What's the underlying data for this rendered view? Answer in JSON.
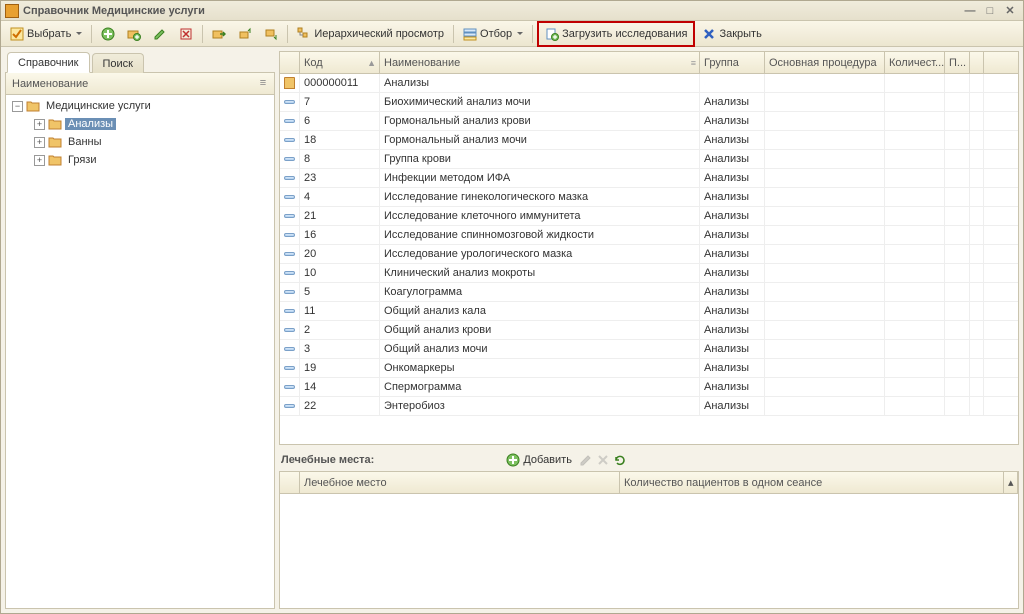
{
  "window": {
    "title": "Справочник Медицинские услуги"
  },
  "toolbar": {
    "select": "Выбрать",
    "hier_view": "Иерархический просмотр",
    "filter": "Отбор",
    "load_research": "Загрузить исследования",
    "close": "Закрыть"
  },
  "tabs": {
    "directory": "Справочник",
    "search": "Поиск"
  },
  "tree": {
    "col": "Наименование",
    "root": "Медицинские услуги",
    "children": [
      {
        "label": "Анализы",
        "selected": true
      },
      {
        "label": "Ванны",
        "selected": false
      },
      {
        "label": "Грязи",
        "selected": false
      }
    ]
  },
  "grid": {
    "cols": {
      "code": "Код",
      "name": "Наименование",
      "group": "Группа",
      "main_proc": "Основная процедура",
      "qty": "Количест...",
      "p": "П..."
    },
    "rows": [
      {
        "type": "folder",
        "code": "000000011",
        "name": "Анализы",
        "group": ""
      },
      {
        "type": "item",
        "code": "7",
        "name": "Биохимический анализ мочи",
        "group": "Анализы"
      },
      {
        "type": "item",
        "code": "6",
        "name": "Гормональный анализ крови",
        "group": "Анализы"
      },
      {
        "type": "item",
        "code": "18",
        "name": "Гормональный анализ мочи",
        "group": "Анализы"
      },
      {
        "type": "item",
        "code": "8",
        "name": "Группа крови",
        "group": "Анализы"
      },
      {
        "type": "item",
        "code": "23",
        "name": "Инфекции методом ИФА",
        "group": "Анализы"
      },
      {
        "type": "item",
        "code": "4",
        "name": "Исследование гинекологического мазка",
        "group": "Анализы"
      },
      {
        "type": "item",
        "code": "21",
        "name": "Исследование клеточного иммунитета",
        "group": "Анализы"
      },
      {
        "type": "item",
        "code": "16",
        "name": "Исследование спинномозговой жидкости",
        "group": "Анализы"
      },
      {
        "type": "item",
        "code": "20",
        "name": "Исследование урологического мазка",
        "group": "Анализы"
      },
      {
        "type": "item",
        "code": "10",
        "name": "Клинический анализ мокроты",
        "group": "Анализы"
      },
      {
        "type": "item",
        "code": "5",
        "name": "Коагулограмма",
        "group": "Анализы"
      },
      {
        "type": "item",
        "code": "11",
        "name": "Общий анализ кала",
        "group": "Анализы"
      },
      {
        "type": "item",
        "code": "2",
        "name": "Общий анализ крови",
        "group": "Анализы"
      },
      {
        "type": "item",
        "code": "3",
        "name": "Общий анализ мочи",
        "group": "Анализы"
      },
      {
        "type": "item",
        "code": "19",
        "name": "Онкомаркеры",
        "group": "Анализы"
      },
      {
        "type": "item",
        "code": "14",
        "name": "Спермограмма",
        "group": "Анализы"
      },
      {
        "type": "item",
        "code": "22",
        "name": "Энтеробиоз",
        "group": "Анализы"
      }
    ]
  },
  "bottom": {
    "title": "Лечебные места:",
    "add": "Добавить",
    "cols": {
      "place": "Лечебное место",
      "patients": "Количество пациентов в одном сеансе"
    }
  }
}
